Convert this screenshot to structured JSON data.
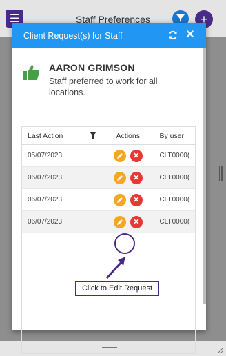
{
  "app": {
    "title": "Staff Preferences",
    "add_label": "+"
  },
  "modal": {
    "title": "Client Request(s) for Staff",
    "close_label": "✕"
  },
  "staff": {
    "name": "AARON GRIMSON",
    "description": "Staff preferred to work for all locations."
  },
  "grid": {
    "columns": [
      "Last Action",
      "Actions",
      "By user"
    ],
    "rows": [
      {
        "last_action": "05/07/2023",
        "by_user": "CLT0000("
      },
      {
        "last_action": "06/07/2023",
        "by_user": "CLT0000("
      },
      {
        "last_action": "06/07/2023",
        "by_user": "CLT0000("
      },
      {
        "last_action": "06/07/2023",
        "by_user": "CLT0000("
      }
    ]
  },
  "callout": {
    "text": "Click to Edit Request"
  },
  "colors": {
    "accent": "#2196f3",
    "brand_purple": "#4a2a88",
    "edit": "#f5a623",
    "delete": "#e53935",
    "thumb": "#43a047"
  },
  "icons": [
    "menu-icon",
    "filter-icon",
    "plus-icon",
    "refresh-icon",
    "close-icon",
    "thumbs-up-icon",
    "pencil-icon",
    "x-icon",
    "resize-grip-icon"
  ]
}
